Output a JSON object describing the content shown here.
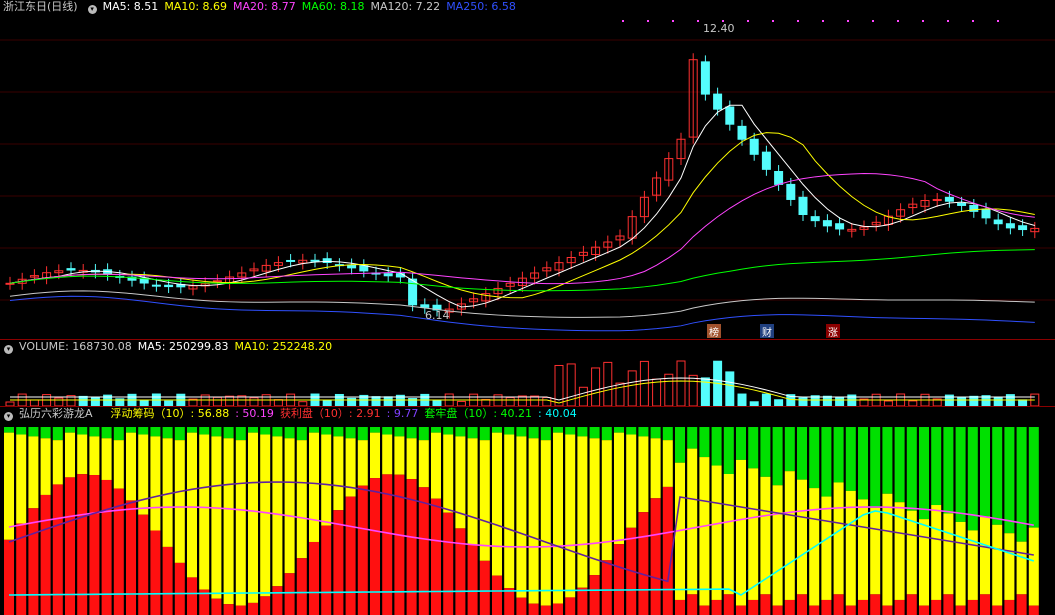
{
  "main_panel": {
    "title": "浙江东日(日线)",
    "indicators": [
      {
        "label": "MA5: 8.51",
        "color": "#ffffff"
      },
      {
        "label": "MA10: 8.69",
        "color": "#ffff00"
      },
      {
        "label": "MA20: 8.77",
        "color": "#ff44ff"
      },
      {
        "label": "MA60: 8.18",
        "color": "#00ff00"
      },
      {
        "label": "MA120: 7.22",
        "color": "#c8c8c8"
      },
      {
        "label": "MA250: 6.58",
        "color": "#3050ff"
      }
    ],
    "high_label": "12.40",
    "low_label": "6.14",
    "event_tags": [
      {
        "text": "榜",
        "color": "#a0522d"
      },
      {
        "text": "财",
        "color": "#204080"
      },
      {
        "text": "涨",
        "color": "#8b0000"
      }
    ]
  },
  "volume_panel": {
    "title": "VOLUME: 168730.08",
    "indicators": [
      {
        "label": "MA5: 250299.83",
        "color": "#ffffff"
      },
      {
        "label": "MA10: 252248.20",
        "color": "#ffff00"
      }
    ]
  },
  "indicator_panel": {
    "title": "弘历六彩游龙A",
    "indicators": [
      {
        "label": "浮动筹码（10）: 56.88",
        "color": "#ffff00"
      },
      {
        "label": ": 50.19",
        "color": "#ff44ff"
      },
      {
        "label": "获利盘（10）: 2.91",
        "color": "#ff3030"
      },
      {
        "label": ": 9.77",
        "color": "#8040ff"
      },
      {
        "label": "套牢盘（10）: 40.21",
        "color": "#00ff00"
      },
      {
        "label": ": 40.04",
        "color": "#00ffff"
      }
    ]
  },
  "colors": {
    "up": "#ff3030",
    "down": "#54fcfc",
    "grid": "#8b0000"
  },
  "icons": [
    "panel-menu-icon"
  ]
}
